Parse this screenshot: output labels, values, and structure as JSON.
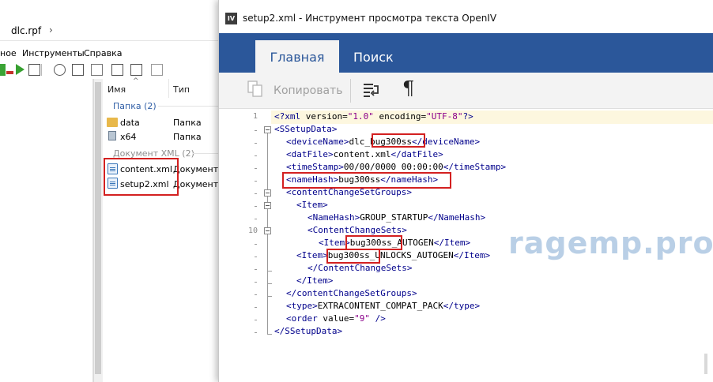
{
  "explorer": {
    "path": "dlc.rpf",
    "path_sep": "›",
    "menu": [
      "ное",
      "Инструменты",
      "Справка"
    ],
    "columns": {
      "name": "Имя",
      "type": "Тип"
    },
    "groups": {
      "folders": "Папка (2)",
      "xml_docs": "Документ XML (2)"
    },
    "rows": [
      {
        "name": "data",
        "type": "Папка",
        "icon": "folder-icon"
      },
      {
        "name": "x64",
        "type": "Папка",
        "icon": "archive-icon"
      },
      {
        "name": "content.xml",
        "type": "Документ X",
        "icon": "xml-document-icon"
      },
      {
        "name": "setup2.xml",
        "type": "Документ X",
        "icon": "xml-document-icon",
        "selected": true
      }
    ]
  },
  "viewer": {
    "app_icon": "IV",
    "title": "setup2.xml - Инструмент просмотра текста OpenIV",
    "tabs": {
      "home": "Главная",
      "search": "Поиск"
    },
    "toolbar": {
      "copy_label": "Копировать",
      "wrap_icon": "word-wrap-icon",
      "para_glyph": "¶"
    },
    "line_number_1": "1",
    "line_number_10": "10",
    "code": {
      "l1a": "<?",
      "l1b": "xml",
      "l1c": " version=",
      "l1d": "\"1.0\"",
      "l1e": " encoding=",
      "l1f": "\"UTF-8\"",
      "l1g": "?>",
      "l2": "<SSetupData>",
      "l3a": "<deviceName>",
      "l3b": "dlc_",
      "l3c": "bug300ss",
      "l3d": "</deviceName>",
      "l4a": "<datFile>",
      "l4b": "content.xml",
      "l4c": "</datFile>",
      "l5a": "<timeStamp>",
      "l5b": "00/00/0000 00:00:00",
      "l5c": "</timeStamp>",
      "l6a": "<nameHash>",
      "l6b": "bug300ss",
      "l6c": "</nameHash>",
      "l7": "<contentChangeSetGroups>",
      "l8": "<Item>",
      "l9a": "<NameHash>",
      "l9b": "GROUP_STARTUP",
      "l9c": "</NameHash>",
      "l10": "<ContentChangeSets>",
      "l11a": "<Item>",
      "l11b": "bug300ss",
      "l11c": "_AUTOGEN",
      "l11d": "</Item>",
      "l12a": "<Item>",
      "l12b": "bug300ss",
      "l12c": "_UNLOCKS_AUTOGEN",
      "l12d": "</Item>",
      "l13": "</ContentChangeSets>",
      "l14": "</Item>",
      "l15": "</contentChangeSetGroups>",
      "l16a": "<type>",
      "l16b": "EXTRACONTENT_COMPAT_PACK",
      "l16c": "</type>",
      "l17a": "<order",
      "l17b": " value=",
      "l17c": "\"9\"",
      "l17d": " />",
      "l18": "</SSetupData>"
    }
  },
  "watermark": "ragemp.pro",
  "colors": {
    "ribbon": "#2b579a",
    "highlight": "#d32020",
    "tag": "#00008b",
    "string": "#8b008b"
  }
}
